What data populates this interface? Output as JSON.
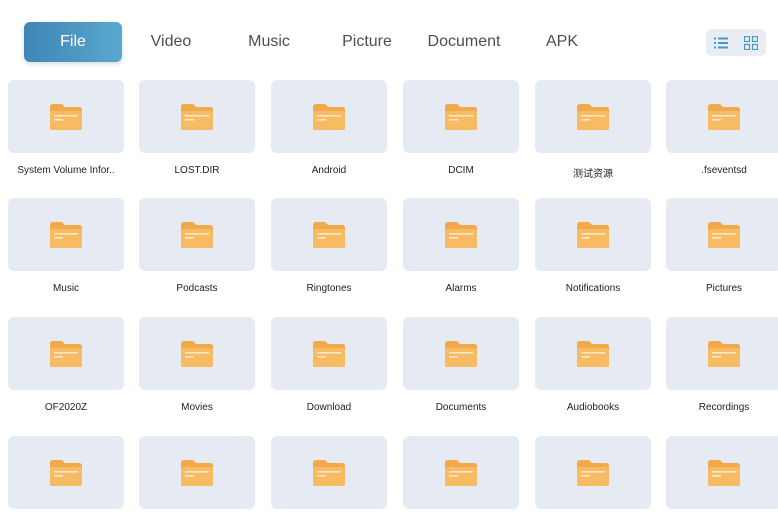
{
  "tabs": [
    {
      "label": "File",
      "active": true
    },
    {
      "label": "Video",
      "active": false
    },
    {
      "label": "Music",
      "active": false
    },
    {
      "label": "Picture",
      "active": false
    },
    {
      "label": "Document",
      "active": false
    },
    {
      "label": "APK",
      "active": false
    }
  ],
  "view_toggle": {
    "list_icon": "list-view-icon",
    "grid_icon": "grid-view-icon",
    "selected": "grid"
  },
  "colors": {
    "accent": "#4a97c4",
    "folder": "#f2a94a",
    "tile_bg": "#e6eaf3"
  },
  "folders": [
    "System Volume Infor..",
    "LOST.DIR",
    "Android",
    "DCIM",
    "测试资源",
    ".fseventsd",
    "Music",
    "Podcasts",
    "Ringtones",
    "Alarms",
    "Notifications",
    "Pictures",
    "OF2020Z",
    "Movies",
    "Download",
    "Documents",
    "Audiobooks",
    "Recordings",
    "",
    "",
    "",
    "",
    "",
    ""
  ]
}
